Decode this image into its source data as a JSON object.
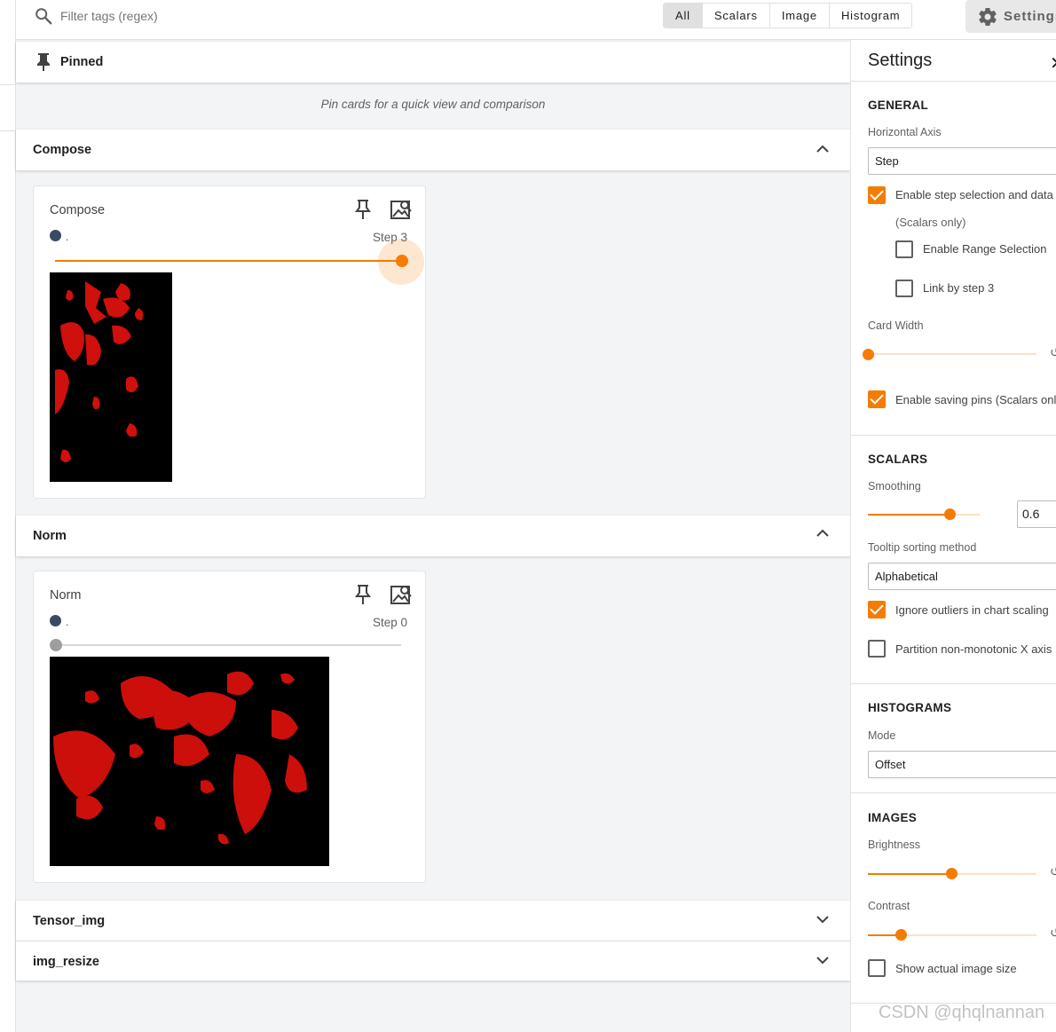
{
  "search": {
    "placeholder": "Filter tags (regex)"
  },
  "type_filter": [
    "All",
    "Scalars",
    "Image",
    "Histogram"
  ],
  "settings_button": {
    "label": "Settings"
  },
  "pinned": {
    "title": "Pinned",
    "empty_message": "Pin cards for a quick view and comparison"
  },
  "groups": [
    {
      "title": "Compose",
      "expanded": true,
      "card": {
        "title": "Compose",
        "run": ".",
        "step_label": "Step 3",
        "slider_value": 1.0
      }
    },
    {
      "title": "Norm",
      "expanded": true,
      "card": {
        "title": "Norm",
        "run": ".",
        "step_label": "Step 0",
        "slider_value": 0.0
      }
    },
    {
      "title": "Tensor_img",
      "expanded": false
    },
    {
      "title": "img_resize",
      "expanded": false
    }
  ],
  "settings": {
    "title": "Settings",
    "general": {
      "heading": "GENERAL",
      "horizontal_axis_label": "Horizontal Axis",
      "horizontal_axis_value": "Step",
      "step_selection": "Enable step selection and data",
      "scalars_only": "(Scalars only)",
      "range_selection": "Enable Range Selection",
      "link_by_step": "Link by step 3",
      "card_width_label": "Card Width",
      "card_width_value": 0.0,
      "saving_pins": "Enable saving pins (Scalars only"
    },
    "scalars": {
      "heading": "SCALARS",
      "smoothing_label": "Smoothing",
      "smoothing_value": "0.6",
      "tooltip_label": "Tooltip sorting method",
      "tooltip_value": "Alphabetical",
      "ignore_outliers": "Ignore outliers in chart scaling",
      "partition": "Partition non-monotonic X axis"
    },
    "histograms": {
      "heading": "HISTOGRAMS",
      "mode_label": "Mode",
      "mode_value": "Offset"
    },
    "images": {
      "heading": "IMAGES",
      "brightness_label": "Brightness",
      "brightness_value": 0.5,
      "contrast_label": "Contrast",
      "contrast_value": 0.2,
      "actual_size": "Show actual image size"
    }
  },
  "colors": {
    "accent": "#f57c00",
    "run_dot": "#3a4a64"
  },
  "watermark": "CSDN @qhqlnannan"
}
